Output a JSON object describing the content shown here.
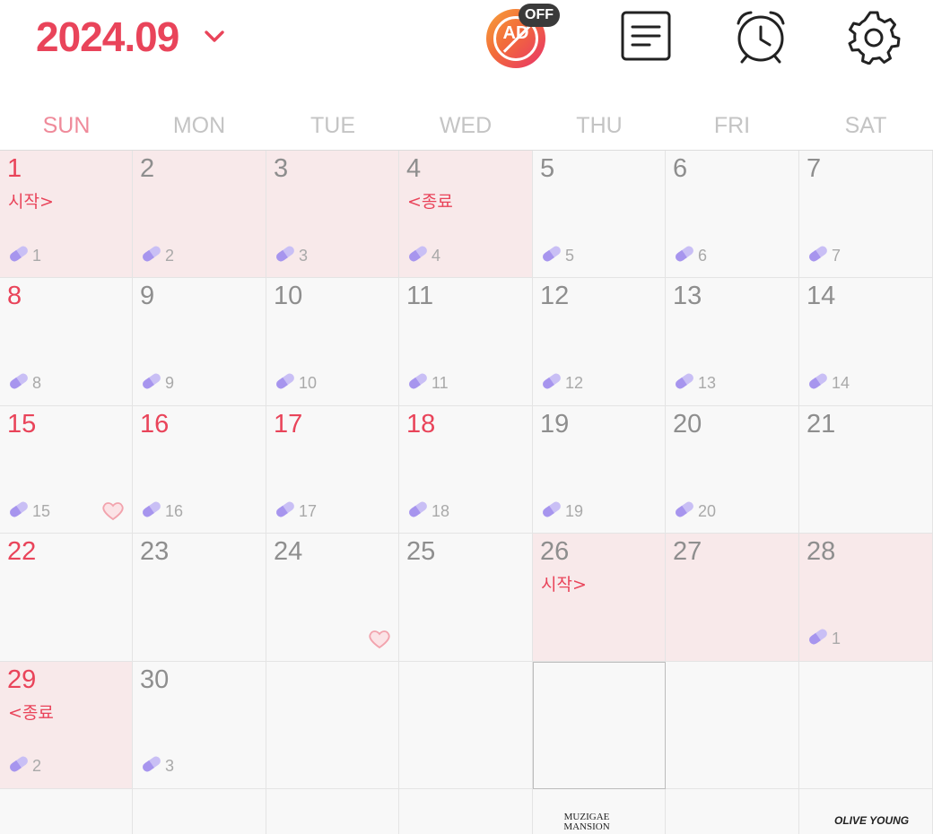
{
  "header": {
    "month": "2024.09",
    "ad_label": "AD",
    "ad_badge": "OFF"
  },
  "weekdays": [
    "SUN",
    "MON",
    "TUE",
    "WED",
    "THU",
    "FRI",
    "SAT"
  ],
  "weeks": [
    [
      {
        "day": "1",
        "red": true,
        "pink": true,
        "note": "시작>",
        "pill": "1"
      },
      {
        "day": "2",
        "red": false,
        "pink": true,
        "pill": "2"
      },
      {
        "day": "3",
        "red": false,
        "pink": true,
        "pill": "3"
      },
      {
        "day": "4",
        "red": false,
        "pink": true,
        "note": "<종료",
        "pill": "4"
      },
      {
        "day": "5",
        "red": false,
        "pill": "5"
      },
      {
        "day": "6",
        "red": false,
        "pill": "6"
      },
      {
        "day": "7",
        "red": false,
        "pill": "7"
      }
    ],
    [
      {
        "day": "8",
        "red": true,
        "pill": "8"
      },
      {
        "day": "9",
        "red": false,
        "pill": "9"
      },
      {
        "day": "10",
        "red": false,
        "pill": "10"
      },
      {
        "day": "11",
        "red": false,
        "pill": "11"
      },
      {
        "day": "12",
        "red": false,
        "pill": "12"
      },
      {
        "day": "13",
        "red": false,
        "pill": "13"
      },
      {
        "day": "14",
        "red": false,
        "pill": "14"
      }
    ],
    [
      {
        "day": "15",
        "red": true,
        "pill": "15",
        "heart": true
      },
      {
        "day": "16",
        "red": true,
        "pill": "16"
      },
      {
        "day": "17",
        "red": true,
        "pill": "17"
      },
      {
        "day": "18",
        "red": true,
        "pill": "18"
      },
      {
        "day": "19",
        "red": false,
        "pill": "19"
      },
      {
        "day": "20",
        "red": false,
        "pill": "20"
      },
      {
        "day": "21",
        "red": false
      }
    ],
    [
      {
        "day": "22",
        "red": true
      },
      {
        "day": "23",
        "red": false
      },
      {
        "day": "24",
        "red": false,
        "heart": true
      },
      {
        "day": "25",
        "red": false
      },
      {
        "day": "26",
        "red": false,
        "pink": true,
        "note": "시작>"
      },
      {
        "day": "27",
        "red": false,
        "pink": true
      },
      {
        "day": "28",
        "red": false,
        "pink": true,
        "pill": "1"
      }
    ],
    [
      {
        "day": "29",
        "red": true,
        "pink": true,
        "note": "<종료",
        "pill": "2"
      },
      {
        "day": "30",
        "red": false,
        "pill": "3"
      },
      {
        "day": "",
        "red": false
      },
      {
        "day": "",
        "red": false
      },
      {
        "day": "",
        "red": false,
        "outlined": true
      },
      {
        "day": "",
        "red": false
      },
      {
        "day": "",
        "red": false
      }
    ]
  ],
  "footer_brands": {
    "thu": "MUZIGAE MANSION",
    "sat": "OLIVE YOUNG"
  },
  "colors": {
    "accent": "#e9445a",
    "pink_range": "#f8e9ea",
    "pill": "#b3a3f0"
  }
}
